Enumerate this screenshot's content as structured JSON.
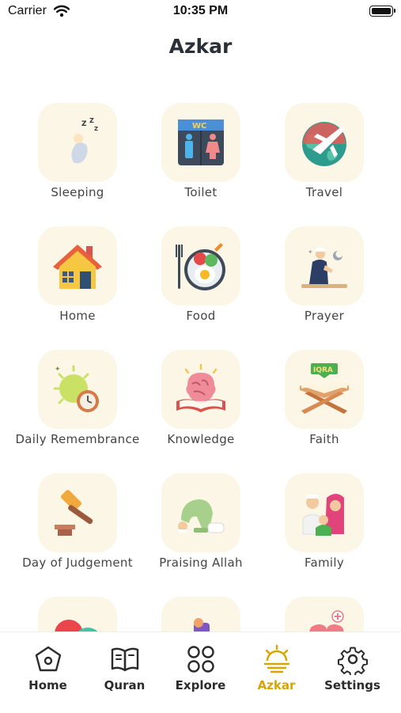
{
  "status_bar": {
    "carrier": "Carrier",
    "time": "10:35 PM"
  },
  "header": {
    "title": "Azkar"
  },
  "categories": [
    {
      "label": "Sleeping",
      "icon": "sleeping-moon-icon"
    },
    {
      "label": "Toilet",
      "icon": "toilet-wc-icon"
    },
    {
      "label": "Travel",
      "icon": "travel-globe-plane-icon"
    },
    {
      "label": "Home",
      "icon": "house-icon"
    },
    {
      "label": "Food",
      "icon": "food-plate-icon"
    },
    {
      "label": "Prayer",
      "icon": "praying-man-icon"
    },
    {
      "label": "Daily Remembrance",
      "icon": "sun-clock-icon"
    },
    {
      "label": "Knowledge",
      "icon": "brain-book-icon"
    },
    {
      "label": "Faith",
      "icon": "quran-stand-icon"
    },
    {
      "label": "Day of Judgement",
      "icon": "gavel-icon"
    },
    {
      "label": "Praising Allah",
      "icon": "prostrating-man-icon"
    },
    {
      "label": "Family",
      "icon": "family-icon"
    },
    {
      "label": "",
      "icon": "emotions-faces-icon"
    },
    {
      "label": "",
      "icon": "sleeping-person-icon"
    },
    {
      "label": "",
      "icon": "health-heart-icon"
    }
  ],
  "tab_bar": {
    "items": [
      {
        "label": "Home",
        "icon": "home-pentagon-icon"
      },
      {
        "label": "Quran",
        "icon": "open-book-icon"
      },
      {
        "label": "Explore",
        "icon": "grid-circles-icon"
      },
      {
        "label": "Azkar",
        "icon": "sunrise-icon"
      },
      {
        "label": "Settings",
        "icon": "gear-icon"
      }
    ],
    "active": "Azkar"
  },
  "colors": {
    "accent": "#d9a400",
    "tile_background": "#fbf6e6",
    "title": "#2a3036",
    "tab_label": "#2b2b2b"
  }
}
